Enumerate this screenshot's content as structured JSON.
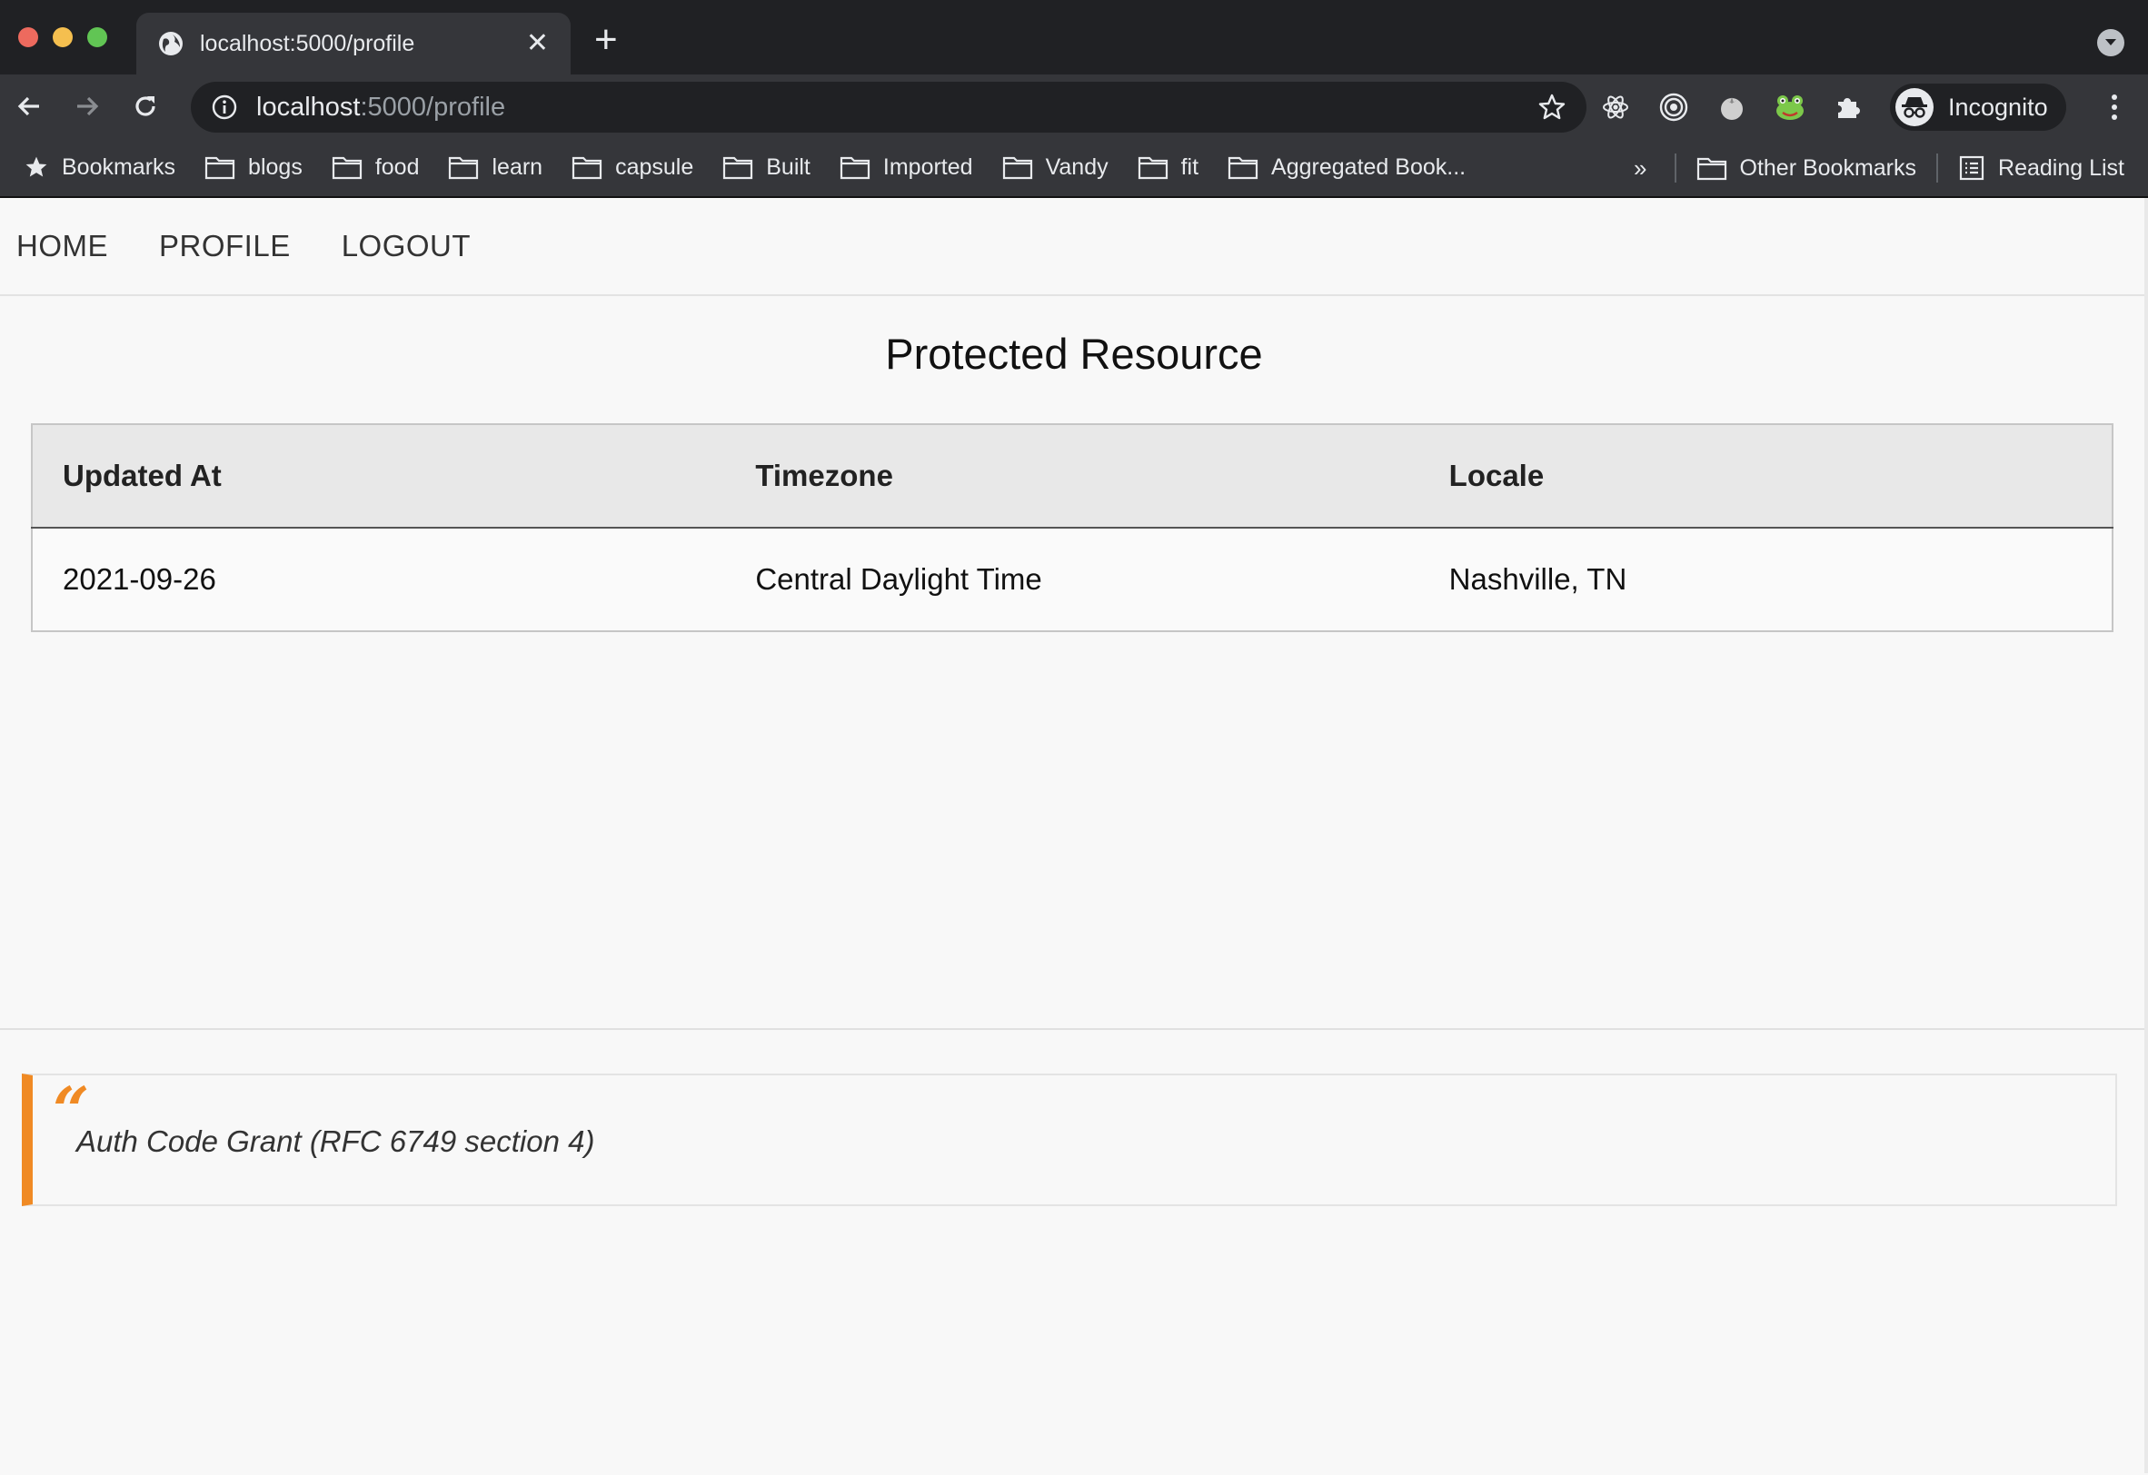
{
  "browser": {
    "tab_title": "localhost:5000/profile",
    "url_host": "localhost",
    "url_rest": ":5000/profile",
    "profile_label": "Incognito",
    "bookmarks": [
      {
        "label": "Bookmarks",
        "icon": "star-icon"
      },
      {
        "label": "blogs",
        "icon": "folder-icon"
      },
      {
        "label": "food",
        "icon": "folder-icon"
      },
      {
        "label": "learn",
        "icon": "folder-icon"
      },
      {
        "label": "capsule",
        "icon": "folder-icon"
      },
      {
        "label": "Built",
        "icon": "folder-icon"
      },
      {
        "label": "Imported",
        "icon": "folder-icon"
      },
      {
        "label": "Vandy",
        "icon": "folder-icon"
      },
      {
        "label": "fit",
        "icon": "folder-icon"
      },
      {
        "label": "Aggregated Book...",
        "icon": "folder-icon"
      }
    ],
    "overflow_label": "»",
    "other_bookmarks": "Other Bookmarks",
    "reading_list": "Reading List"
  },
  "nav": {
    "home": "HOME",
    "profile": "PROFILE",
    "logout": "LOGOUT"
  },
  "main": {
    "title": "Protected Resource",
    "table": {
      "headers": [
        "Updated At",
        "Timezone",
        "Locale"
      ],
      "rows": [
        [
          "2021-09-26",
          "Central Daylight Time",
          "Nashville, TN"
        ]
      ]
    }
  },
  "footer_quote": {
    "mark": "“",
    "text": "Auth Code Grant (RFC 6749 section 4)"
  },
  "colors": {
    "accent": "#f08a24",
    "chrome_dark": "#202124",
    "chrome_toolbar": "#35363a"
  }
}
